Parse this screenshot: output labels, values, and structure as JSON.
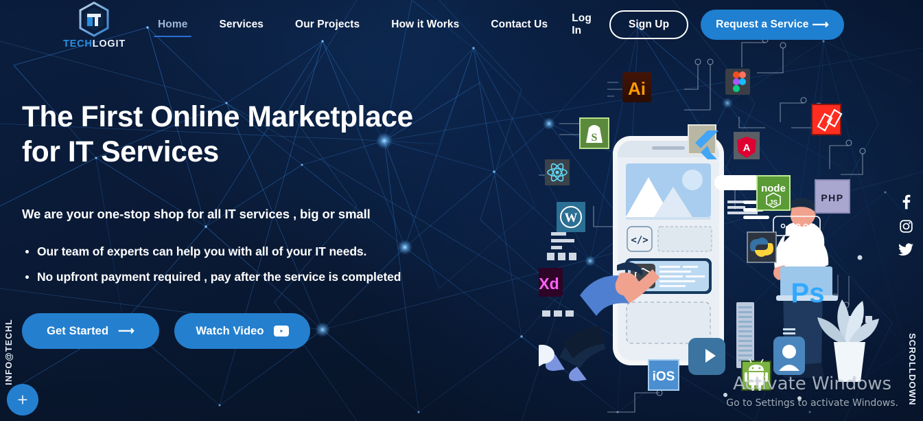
{
  "brand": {
    "logo_icon": "techlogit-hexagon-logo",
    "name_part1": "TECH",
    "name_part2": "LOGIT"
  },
  "nav": {
    "items": [
      {
        "label": "Home",
        "active": true
      },
      {
        "label": "Services",
        "active": false
      },
      {
        "label": "Our Projects",
        "active": false
      },
      {
        "label": "How it Works",
        "active": false
      },
      {
        "label": "Contact Us",
        "active": false
      }
    ]
  },
  "header_actions": {
    "login_label": "Log In",
    "signup_label": "Sign Up",
    "request_label": "Request a Service",
    "request_arrow": "⟶"
  },
  "hero": {
    "heading_line1": "The First Online Marketplace",
    "heading_line2": "for IT Services",
    "subheading": "We are your one-stop shop for all IT services , big or small",
    "bullets": [
      "Our team of experts can help you with all of your IT needs.",
      " No upfront payment required , pay after the service is completed"
    ],
    "cta_primary": "Get Started",
    "cta_primary_arrow": "⟶",
    "cta_secondary": "Watch Video",
    "cta_secondary_icon": "youtube-play-icon"
  },
  "rails": {
    "email_vertical": "INFO@TECHL",
    "scroll_label": "SCROLLDOWN",
    "fab_label": "+",
    "social": [
      {
        "name": "facebook-icon",
        "label": "Facebook"
      },
      {
        "name": "instagram-icon",
        "label": "Instagram"
      },
      {
        "name": "twitter-icon",
        "label": "Twitter"
      }
    ]
  },
  "illustration": {
    "tech_badges": [
      {
        "name": "adobe-illustrator-icon",
        "label": "Ai"
      },
      {
        "name": "figma-icon",
        "label": ""
      },
      {
        "name": "shopify-icon",
        "label": ""
      },
      {
        "name": "flutter-icon",
        "label": ""
      },
      {
        "name": "laravel-icon",
        "label": ""
      },
      {
        "name": "angular-icon",
        "label": "A"
      },
      {
        "name": "react-icon",
        "label": ""
      },
      {
        "name": "nodejs-icon",
        "label": "node JS"
      },
      {
        "name": "php-icon",
        "label": "PHP"
      },
      {
        "name": "wordpress-icon",
        "label": ""
      },
      {
        "name": "adobe-xd-icon",
        "label": "Xd"
      },
      {
        "name": "unity-icon",
        "label": ""
      },
      {
        "name": "python-icon",
        "label": ""
      },
      {
        "name": "photoshop-icon",
        "label": "Ps"
      },
      {
        "name": "ios-icon",
        "label": "iOS"
      },
      {
        "name": "android-icon",
        "label": ""
      },
      {
        "name": "code-brackets-icon",
        "label": "</>"
      }
    ]
  },
  "watermark": {
    "line1": "Activate Windows",
    "line2": "Go to Settings to activate Windows."
  },
  "colors": {
    "background": "#0a1b39",
    "accent_blue": "#2480cf",
    "nav_active": "#9fb8d8",
    "underline": "#2d6fd6",
    "logo_blue": "#2a8fe0"
  }
}
